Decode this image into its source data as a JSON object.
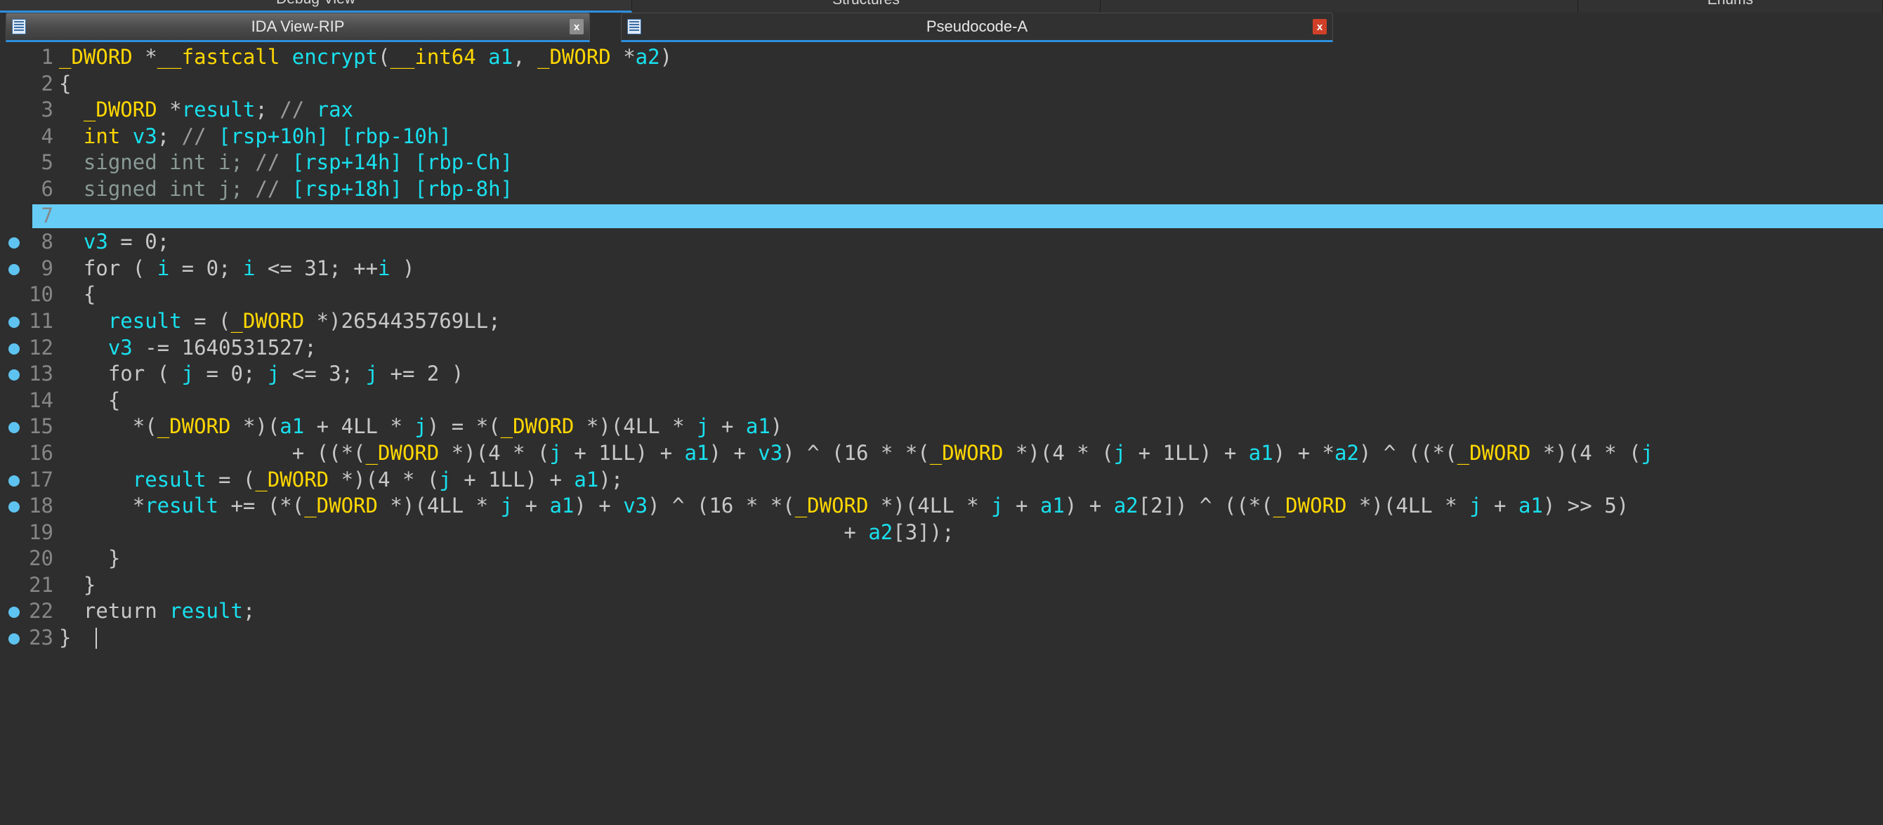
{
  "outer_tabs": [
    {
      "label": "Debug View",
      "active": true
    },
    {
      "label": "Structures",
      "active": false
    },
    {
      "label": "Enums",
      "active": false
    }
  ],
  "windows": [
    {
      "title": "IDA View-RIP",
      "active": false,
      "close_label": "x",
      "icon": "ida-view-icon"
    },
    {
      "title": "Pseudocode-A",
      "active": true,
      "close_label": "x",
      "icon": "pseudocode-icon"
    }
  ],
  "colors": {
    "background": "#2e2e2e",
    "keyword": "#ffd700",
    "variable": "#19e0ee",
    "plain": "#c8c8c8",
    "dim": "#8a9a96",
    "comment": "#9a9a9a",
    "line_number": "#868686",
    "highlight": "#67cdf7",
    "breakpoint": "#5ec3f0",
    "accent": "#2d8fdd"
  },
  "code": {
    "lines": [
      {
        "n": "1",
        "bp": false,
        "hl": false,
        "text": "_DWORD *__fastcall encrypt(__int64 a1, _DWORD *a2)"
      },
      {
        "n": "2",
        "bp": false,
        "hl": false,
        "text": "{"
      },
      {
        "n": "3",
        "bp": false,
        "hl": false,
        "text": "  _DWORD *result; // rax"
      },
      {
        "n": "4",
        "bp": false,
        "hl": false,
        "text": "  int v3; // [rsp+10h] [rbp-10h]"
      },
      {
        "n": "5",
        "bp": false,
        "hl": false,
        "text": "  signed int i; // [rsp+14h] [rbp-Ch]"
      },
      {
        "n": "6",
        "bp": false,
        "hl": false,
        "text": "  signed int j; // [rsp+18h] [rbp-8h]"
      },
      {
        "n": "7",
        "bp": false,
        "hl": true,
        "text": ""
      },
      {
        "n": "8",
        "bp": true,
        "hl": false,
        "text": "  v3 = 0;"
      },
      {
        "n": "9",
        "bp": true,
        "hl": false,
        "text": "  for ( i = 0; i <= 31; ++i )"
      },
      {
        "n": "10",
        "bp": false,
        "hl": false,
        "text": "  {"
      },
      {
        "n": "11",
        "bp": true,
        "hl": false,
        "text": "    result = (_DWORD *)2654435769LL;"
      },
      {
        "n": "12",
        "bp": true,
        "hl": false,
        "text": "    v3 -= 1640531527;"
      },
      {
        "n": "13",
        "bp": true,
        "hl": false,
        "text": "    for ( j = 0; j <= 3; j += 2 )"
      },
      {
        "n": "14",
        "bp": false,
        "hl": false,
        "text": "    {"
      },
      {
        "n": "15",
        "bp": true,
        "hl": false,
        "text": "      *(_DWORD *)(a1 + 4LL * j) = *(_DWORD *)(4LL * j + a1)"
      },
      {
        "n": "16",
        "bp": false,
        "hl": false,
        "text": "                   + ((*(_DWORD *)(4 * (j + 1LL) + a1) + v3) ^ (16 * *(_DWORD *)(4 * (j + 1LL) + a1) + *a2) ^ ((*(_DWORD *)(4 * (j"
      },
      {
        "n": "17",
        "bp": true,
        "hl": false,
        "text": "      result = (_DWORD *)(4 * (j + 1LL) + a1);"
      },
      {
        "n": "18",
        "bp": true,
        "hl": false,
        "text": "      *result += (*(_DWORD *)(4LL * j + a1) + v3) ^ (16 * *(_DWORD *)(4LL * j + a1) + a2[2]) ^ ((*(_DWORD *)(4LL * j + a1) >> 5)"
      },
      {
        "n": "19",
        "bp": false,
        "hl": false,
        "text": "                                                                + a2[3]);"
      },
      {
        "n": "20",
        "bp": false,
        "hl": false,
        "text": "    }"
      },
      {
        "n": "21",
        "bp": false,
        "hl": false,
        "text": "  }"
      },
      {
        "n": "22",
        "bp": true,
        "hl": false,
        "text": "  return result;"
      },
      {
        "n": "23",
        "bp": true,
        "hl": false,
        "text": "}"
      }
    ]
  }
}
